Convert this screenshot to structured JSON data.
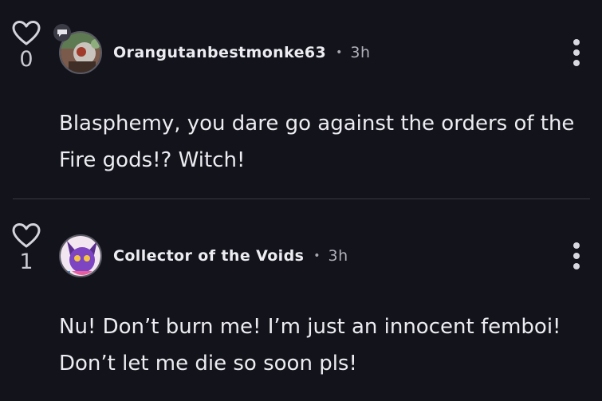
{
  "comments": [
    {
      "like_count": "0",
      "username": "Orangutanbestmonke63",
      "separator": "•",
      "time": "3h",
      "text": "Blasphemy, you dare go against the orders of the Fire gods!? Witch!"
    },
    {
      "like_count": "1",
      "username": "Collector of the Voids",
      "separator": "•",
      "time": "3h",
      "text": "Nu! Don’t burn me! I’m just an innocent femboi! Don’t let me die so soon pls!"
    }
  ],
  "colors": {
    "background": "#13131b",
    "text": "#ececf2",
    "muted": "#b1b1bc",
    "divider": "#3a3a44"
  },
  "icons": {
    "like": "heart-outline-icon",
    "more": "vertical-ellipsis-icon",
    "chat_badge": "speech-bubble-icon"
  }
}
